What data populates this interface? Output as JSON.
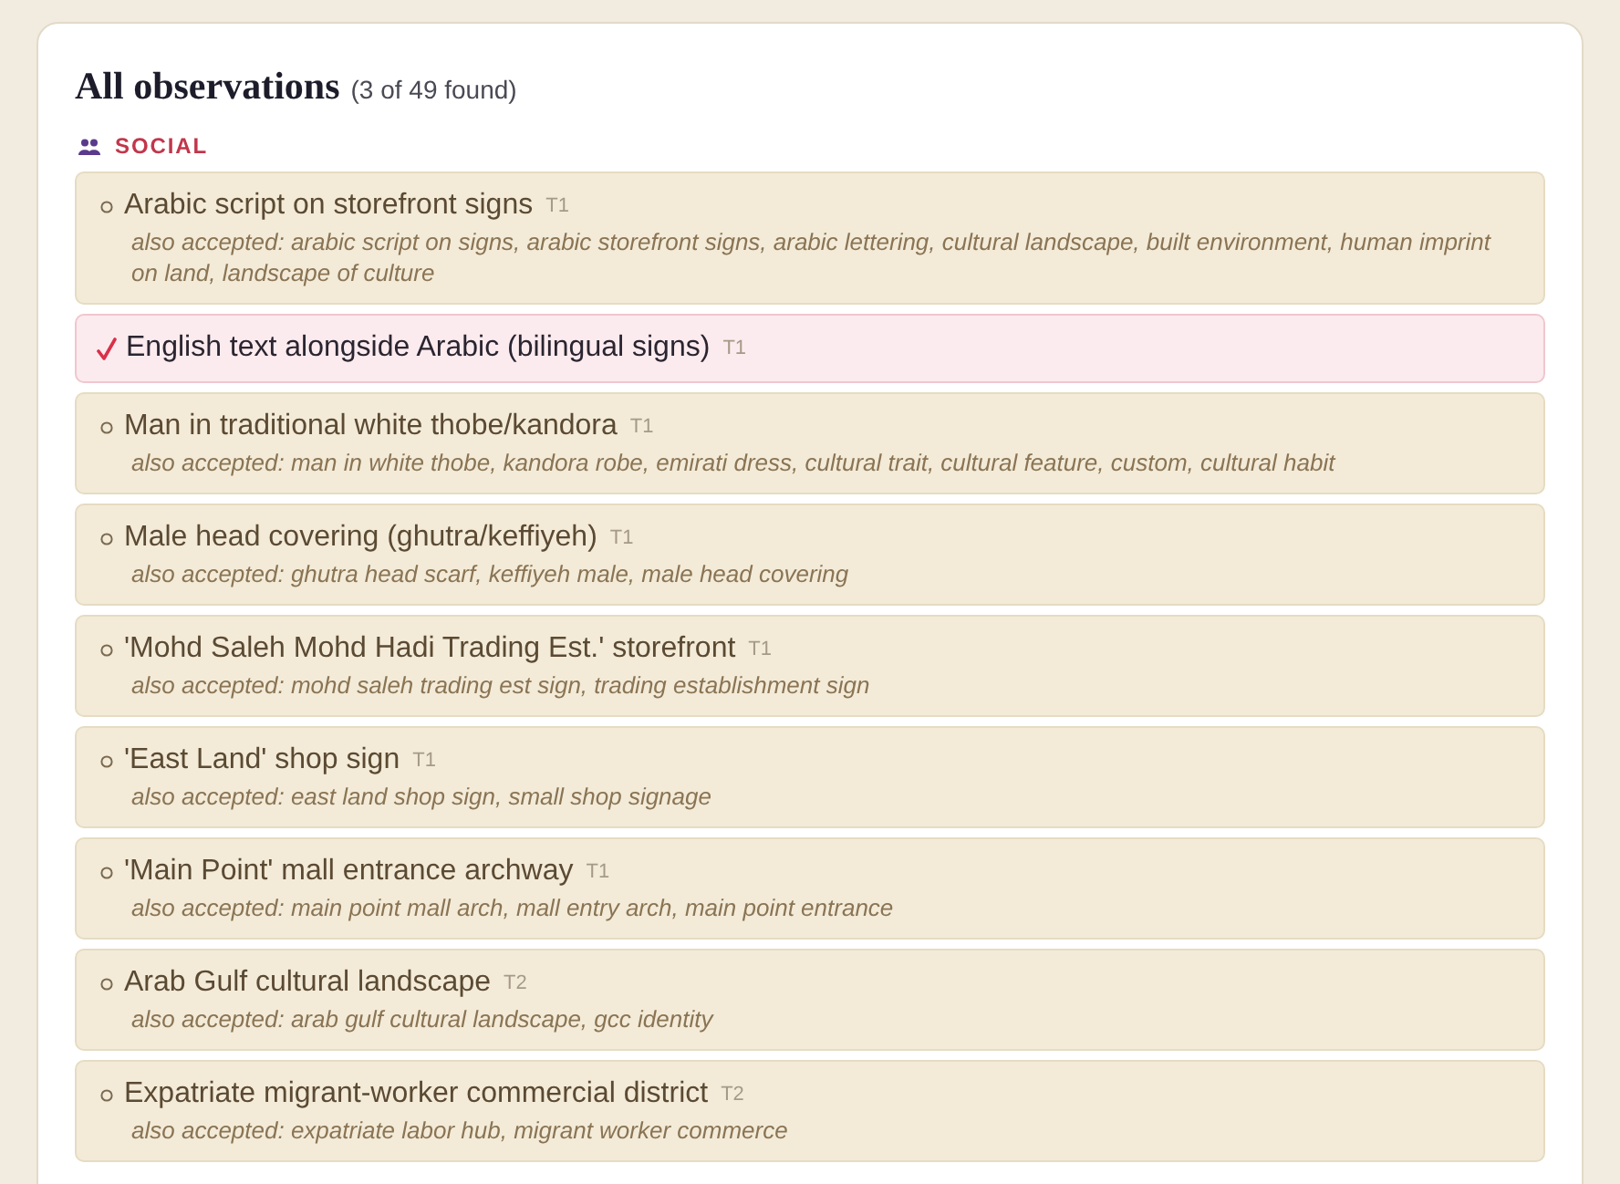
{
  "heading": {
    "title": "All observations",
    "count": "(3 of 49 found)"
  },
  "sections": [
    {
      "label": "SOCIAL",
      "items": [
        {
          "title": "Arabic script on storefront signs",
          "tier": "T1",
          "found": false,
          "note": "also accepted: arabic script on signs, arabic storefront signs, arabic lettering, cultural landscape, built environment, human imprint on land, landscape of culture"
        },
        {
          "title": "English text alongside Arabic (bilingual signs)",
          "tier": "T1",
          "found": true
        },
        {
          "title": "Man in traditional white thobe/kandora",
          "tier": "T1",
          "found": false,
          "note": "also accepted: man in white thobe, kandora robe, emirati dress, cultural trait, cultural feature, custom, cultural habit"
        },
        {
          "title": "Male head covering (ghutra/keffiyeh)",
          "tier": "T1",
          "found": false,
          "note": "also accepted: ghutra head scarf, keffiyeh male, male head covering"
        },
        {
          "title": "'Mohd Saleh Mohd Hadi Trading Est.' storefront",
          "tier": "T1",
          "found": false,
          "note": "also accepted: mohd saleh trading est sign, trading establishment sign"
        },
        {
          "title": "'East Land' shop sign",
          "tier": "T1",
          "found": false,
          "note": "also accepted: east land shop sign, small shop signage"
        },
        {
          "title": "'Main Point' mall entrance archway",
          "tier": "T1",
          "found": false,
          "note": "also accepted: main point mall arch, mall entry arch, main point entrance"
        },
        {
          "title": "Arab Gulf cultural landscape",
          "tier": "T2",
          "found": false,
          "note": "also accepted: arab gulf cultural landscape, gcc identity"
        },
        {
          "title": "Expatriate migrant-worker commercial district",
          "tier": "T2",
          "found": false,
          "note": "also accepted: expatriate labor hub, migrant worker commerce"
        }
      ]
    }
  ]
}
